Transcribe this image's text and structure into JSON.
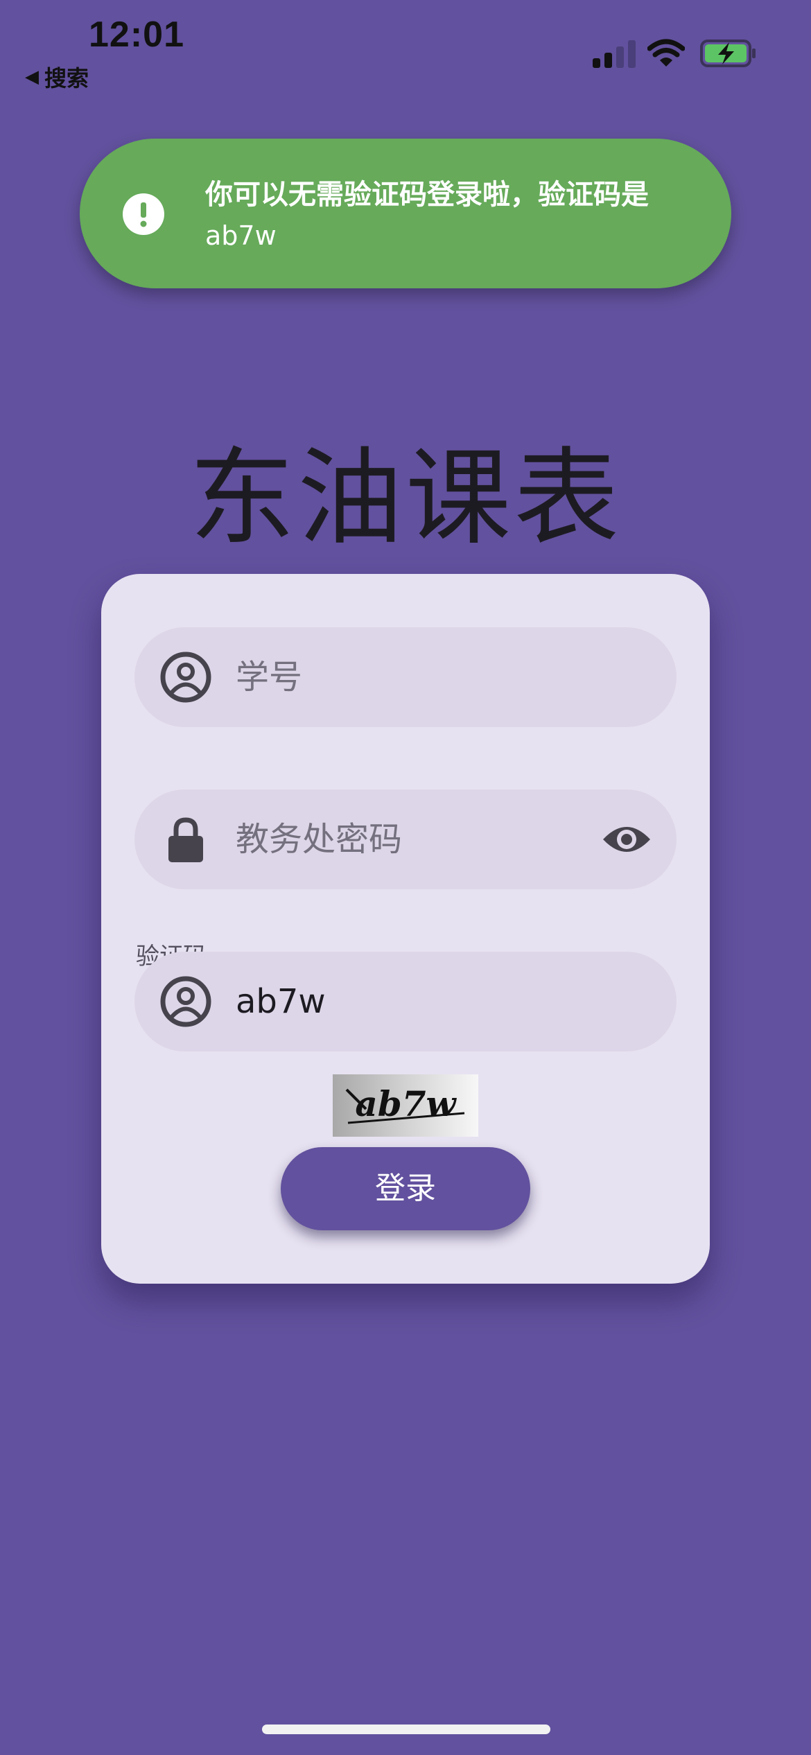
{
  "status_bar": {
    "time": "12:01",
    "back_label": "搜索",
    "back_arrow": "◀",
    "icons": [
      "signal-icon",
      "wifi-icon",
      "battery-charging-icon"
    ]
  },
  "toast": {
    "icon": "alert-circle-icon",
    "message_line1": "你可以无需验证码登录啦，验证码是",
    "message_line2": "ab7w",
    "background_color": "#66aa5a"
  },
  "app": {
    "title": "东油课表",
    "background_color": "#62519e"
  },
  "form": {
    "student_id": {
      "placeholder": "学号",
      "value": "",
      "icon": "account-circle-icon"
    },
    "password": {
      "placeholder": "教务处密码",
      "value": "",
      "icon": "lock-icon",
      "trailing_icon": "eye-icon"
    },
    "captcha": {
      "label": "验证码",
      "value": "ab7w",
      "icon": "account-circle-icon",
      "image_text": "ab7w"
    },
    "login_button": "登录"
  }
}
